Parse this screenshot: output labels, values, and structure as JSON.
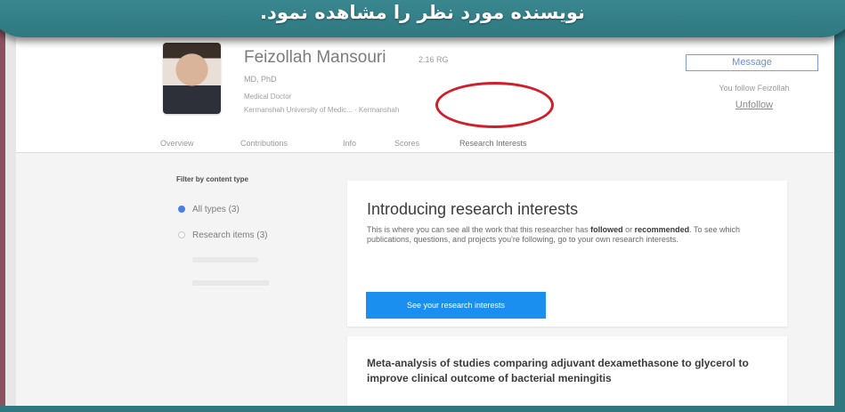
{
  "banner": {
    "caption": "نویسنده مورد نظر را مشاهده نمود."
  },
  "profile": {
    "name": "Feizollah Mansouri",
    "score": "2.16 RG",
    "degree": "MD, PhD",
    "department": "Medical Doctor",
    "institution": "Kermanshah University of Medic... · Kermanshah",
    "message_label": "Message",
    "follow_text": "You follow Feizollah",
    "unfollow_label": "Unfollow"
  },
  "tabs": [
    {
      "label": "Overview"
    },
    {
      "label": "Contributions"
    },
    {
      "label": "Info"
    },
    {
      "label": "Scores"
    },
    {
      "label": "Research Interests",
      "highlighted": true
    }
  ],
  "filter": {
    "title": "Filter by content type",
    "options": [
      {
        "label": "All types (3)",
        "selected": true
      },
      {
        "label": "Research items (3)",
        "selected": false
      }
    ]
  },
  "intro_card": {
    "title": "Introducing research interests",
    "body_1": "This is where you can see all the work that this researcher has ",
    "bold_1": "followed",
    "body_2": " or ",
    "bold_2": "recommended",
    "body_3": ". To see which publications, questions, and projects you're following, go to your own research interests.",
    "button_label": "See your research interests"
  },
  "article": {
    "title": "Meta-analysis of studies comparing adjuvant dexamethasone to glycerol to improve clinical outcome of bacterial meningitis"
  },
  "colors": {
    "banner": "#2f7880",
    "highlight": "#d01f2a",
    "primary_button": "#1a8ff0"
  }
}
